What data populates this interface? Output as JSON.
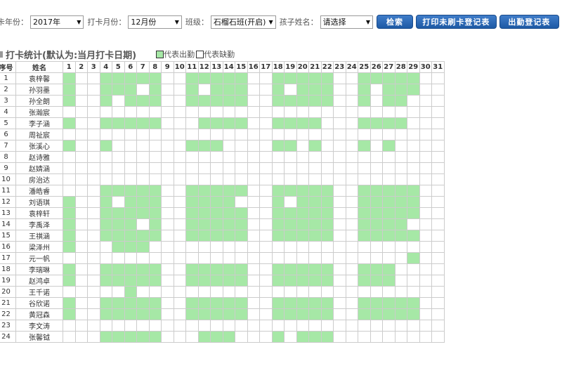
{
  "toolbar": {
    "year_label": "卡年份：",
    "year_value": "2017年",
    "month_label": "打卡月份：",
    "month_value": "12月份",
    "class_label": "班级：",
    "class_value": "石榴石班(开启)",
    "child_label": "孩子姓名：",
    "child_value": "请选择",
    "search_button": "检索",
    "print_unpunched_button": "打印未刷卡登记表",
    "print_attendance_button": "出勤登记表"
  },
  "section": {
    "title": "打卡统计(默认为:当月打卡日期)",
    "legend_present": "代表出勤",
    "legend_absent": "代表缺勤"
  },
  "colors": {
    "present": "#a6e8a6",
    "absent": "#ffffff",
    "button": "#2563ab"
  },
  "table": {
    "header_seq": "序号",
    "header_name": "姓名",
    "days": [
      "1",
      "2",
      "3",
      "4",
      "5",
      "6",
      "7",
      "8",
      "9",
      "10",
      "11",
      "12",
      "13",
      "14",
      "15",
      "16",
      "17",
      "18",
      "19",
      "20",
      "21",
      "22",
      "23",
      "24",
      "25",
      "26",
      "27",
      "28",
      "29",
      "30",
      "31"
    ],
    "rows": [
      {
        "seq": "1",
        "name": "袁梓馨",
        "present": [
          1,
          4,
          5,
          6,
          7,
          8,
          11,
          12,
          13,
          14,
          15,
          18,
          19,
          20,
          21,
          22,
          25,
          26,
          27,
          28,
          29
        ]
      },
      {
        "seq": "2",
        "name": "孙羽墨",
        "present": [
          1,
          4,
          5,
          6,
          8,
          11,
          13,
          14,
          15,
          18,
          20,
          21,
          22,
          25,
          27,
          28,
          29
        ]
      },
      {
        "seq": "3",
        "name": "孙全朗",
        "present": [
          1,
          4,
          6,
          7,
          8,
          11,
          12,
          13,
          14,
          15,
          18,
          19,
          20,
          21,
          22,
          25,
          27,
          28
        ]
      },
      {
        "seq": "4",
        "name": "张瀚宸",
        "present": []
      },
      {
        "seq": "5",
        "name": "李子涵",
        "present": [
          1,
          4,
          5,
          6,
          7,
          8,
          12,
          13,
          14,
          15,
          18,
          19,
          20,
          21,
          25,
          26,
          27,
          28
        ]
      },
      {
        "seq": "6",
        "name": "周祉宸",
        "present": []
      },
      {
        "seq": "7",
        "name": "张溪心",
        "present": [
          1,
          4,
          11,
          12,
          13,
          18,
          19,
          21,
          25,
          27
        ]
      },
      {
        "seq": "8",
        "name": "赵诗雅",
        "present": []
      },
      {
        "seq": "9",
        "name": "赵婧涵",
        "present": []
      },
      {
        "seq": "10",
        "name": "房治达",
        "present": []
      },
      {
        "seq": "11",
        "name": "潘皓睿",
        "present": [
          4,
          5,
          6,
          7,
          8,
          11,
          12,
          13,
          14,
          15,
          18,
          19,
          20,
          21,
          22,
          25,
          26,
          27,
          28,
          29
        ]
      },
      {
        "seq": "12",
        "name": "刘语琪",
        "present": [
          1,
          4,
          6,
          7,
          8,
          11,
          12,
          13,
          14,
          18,
          20,
          21,
          22,
          25,
          26,
          27,
          28,
          29
        ]
      },
      {
        "seq": "13",
        "name": "袁梓轩",
        "present": [
          1,
          4,
          5,
          6,
          7,
          8,
          11,
          12,
          13,
          14,
          15,
          18,
          19,
          20,
          21,
          22,
          25,
          26,
          27,
          28,
          29
        ]
      },
      {
        "seq": "14",
        "name": "李禹泽",
        "present": [
          1,
          4,
          5,
          6,
          8,
          11,
          12,
          13,
          14,
          15,
          18,
          19,
          20,
          21,
          22,
          25,
          26,
          27,
          28
        ]
      },
      {
        "seq": "15",
        "name": "王祺涵",
        "present": [
          1,
          4,
          5,
          6,
          7,
          8,
          11,
          12,
          13,
          14,
          15,
          18,
          19,
          20,
          21,
          22,
          25,
          26,
          27,
          28,
          29
        ]
      },
      {
        "seq": "16",
        "name": "梁泽州",
        "present": [
          1,
          5,
          6,
          7
        ]
      },
      {
        "seq": "17",
        "name": "元一帆",
        "present": [
          29
        ]
      },
      {
        "seq": "18",
        "name": "李瑞琳",
        "present": [
          1,
          4,
          5,
          6,
          7,
          8,
          11,
          12,
          13,
          14,
          15,
          18,
          19,
          20,
          21,
          22,
          25,
          26,
          27
        ]
      },
      {
        "seq": "19",
        "name": "赵鸿卓",
        "present": [
          1,
          4,
          5,
          6,
          7,
          8,
          11,
          12,
          13,
          14,
          15,
          18,
          19,
          20,
          21,
          22,
          25,
          26,
          27
        ]
      },
      {
        "seq": "20",
        "name": "王千诺",
        "present": [
          6
        ]
      },
      {
        "seq": "21",
        "name": "谷欣诺",
        "present": [
          1,
          4,
          5,
          6,
          7,
          8,
          11,
          12,
          13,
          14,
          15,
          18,
          19,
          20,
          21,
          22,
          25,
          26,
          27,
          28,
          29
        ]
      },
      {
        "seq": "22",
        "name": "黄冠森",
        "present": [
          1,
          4,
          5,
          6,
          7,
          8,
          11,
          12,
          13,
          14,
          15,
          18,
          19,
          20,
          21,
          22,
          25,
          26,
          27,
          28,
          29
        ]
      },
      {
        "seq": "23",
        "name": "李文涛",
        "present": []
      },
      {
        "seq": "24",
        "name": "张馨钺",
        "present": [
          4,
          5,
          6,
          7,
          8,
          12,
          13,
          14,
          18,
          20,
          21,
          22
        ]
      }
    ]
  }
}
